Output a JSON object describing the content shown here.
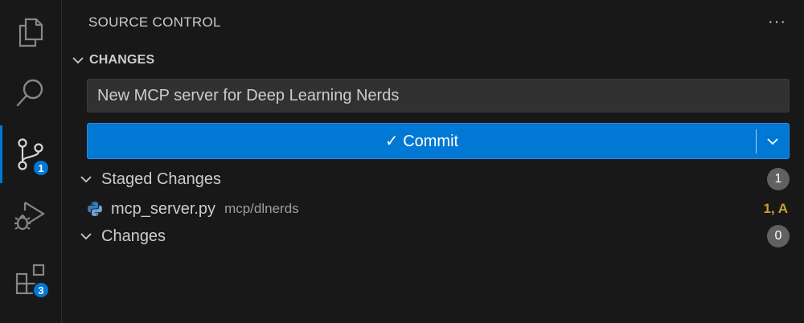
{
  "activity_bar": {
    "items": [
      {
        "icon": "files-icon",
        "badge": ""
      },
      {
        "icon": "search-icon",
        "badge": ""
      },
      {
        "icon": "source-control-icon",
        "badge": "1",
        "active": true
      },
      {
        "icon": "run-debug-icon",
        "badge": ""
      },
      {
        "icon": "extensions-icon",
        "badge": "3"
      }
    ]
  },
  "view": {
    "title": "SOURCE CONTROL",
    "more_icon": "ellipsis-icon"
  },
  "changes_section": {
    "header": "CHANGES",
    "commit_message_value": "New MCP server for Deep Learning Nerds",
    "commit_button_label": "✓ Commit",
    "staged": {
      "label": "Staged Changes",
      "count": "1",
      "files": [
        {
          "name": "mcp_server.py",
          "path": "mcp/dlnerds",
          "status": "1, A",
          "icon": "python-icon"
        }
      ]
    },
    "unstaged": {
      "label": "Changes",
      "count": "0"
    }
  },
  "colors": {
    "accent": "#0078d4",
    "background": "#181818",
    "input_bg": "#313131",
    "status_added": "#c5a332"
  }
}
